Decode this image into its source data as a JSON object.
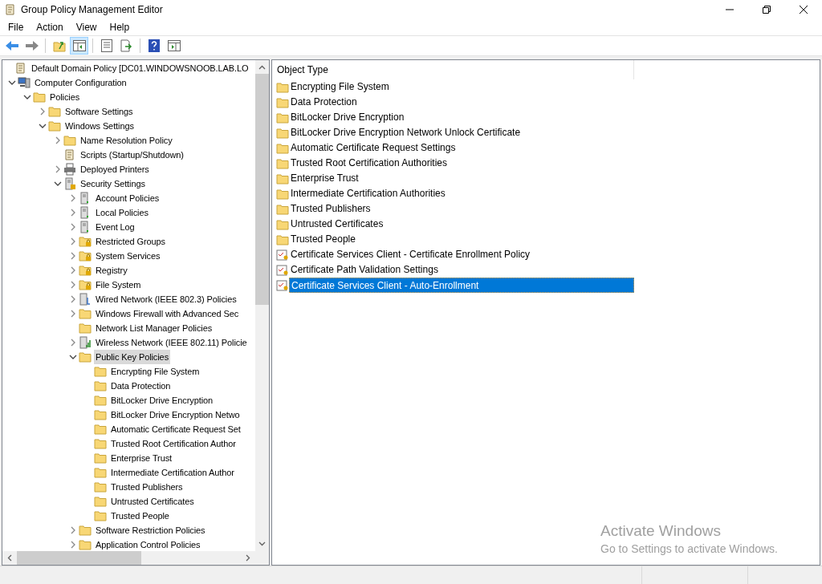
{
  "window": {
    "title": "Group Policy Management Editor"
  },
  "menu": [
    {
      "label": "File"
    },
    {
      "label": "Action"
    },
    {
      "label": "View"
    },
    {
      "label": "Help"
    }
  ],
  "toolbar": [
    {
      "kind": "back",
      "pressed": false
    },
    {
      "kind": "forward",
      "pressed": false
    },
    {
      "kind": "up",
      "pressed": false
    },
    {
      "kind": "tree",
      "pressed": true
    },
    {
      "kind": "properties",
      "pressed": false
    },
    {
      "kind": "export",
      "pressed": false
    },
    {
      "kind": "help",
      "pressed": false
    },
    {
      "kind": "actionpane",
      "pressed": false
    }
  ],
  "tree": [
    {
      "label": "Default Domain Policy [DC01.WINDOWSNOOB.LAB.LO",
      "kind": "policy",
      "selected": false,
      "children": [
        {
          "label": "Computer Configuration",
          "kind": "computer",
          "expanded": true,
          "selected": false,
          "children": [
            {
              "label": "Policies",
              "kind": "folder",
              "expanded": true,
              "selected": false,
              "children": [
                {
                  "label": "Software Settings",
                  "kind": "folder",
                  "expanded": false,
                  "selected": false
                },
                {
                  "label": "Windows Settings",
                  "kind": "folder",
                  "expanded": true,
                  "selected": false,
                  "children": [
                    {
                      "label": "Name Resolution Policy",
                      "kind": "folder",
                      "expanded": false,
                      "selected": false
                    },
                    {
                      "label": "Scripts (Startup/Shutdown)",
                      "kind": "script",
                      "selected": false
                    },
                    {
                      "label": "Deployed Printers",
                      "kind": "printer",
                      "expanded": false,
                      "selected": false
                    },
                    {
                      "label": "Security Settings",
                      "kind": "security",
                      "expanded": true,
                      "selected": false,
                      "children": [
                        {
                          "label": "Account Policies",
                          "kind": "server",
                          "expanded": false,
                          "selected": false
                        },
                        {
                          "label": "Local Policies",
                          "kind": "server",
                          "expanded": false,
                          "selected": false
                        },
                        {
                          "label": "Event Log",
                          "kind": "server",
                          "expanded": false,
                          "selected": false
                        },
                        {
                          "label": "Restricted Groups",
                          "kind": "locked",
                          "expanded": false,
                          "selected": false
                        },
                        {
                          "label": "System Services",
                          "kind": "locked",
                          "expanded": false,
                          "selected": false
                        },
                        {
                          "label": "Registry",
                          "kind": "locked",
                          "expanded": false,
                          "selected": false
                        },
                        {
                          "label": "File System",
                          "kind": "locked",
                          "expanded": false,
                          "selected": false
                        },
                        {
                          "label": "Wired Network (IEEE 802.3) Policies",
                          "kind": "wired",
                          "expanded": false,
                          "selected": false
                        },
                        {
                          "label": "Windows Firewall with Advanced Sec",
                          "kind": "folder",
                          "expanded": false,
                          "selected": false
                        },
                        {
                          "label": "Network List Manager Policies",
                          "kind": "folder",
                          "selected": false
                        },
                        {
                          "label": "Wireless Network (IEEE 802.11) Policie",
                          "kind": "wireless",
                          "expanded": false,
                          "selected": false
                        },
                        {
                          "label": "Public Key Policies",
                          "kind": "folder",
                          "expanded": true,
                          "selected": true,
                          "children": [
                            {
                              "label": "Encrypting File System",
                              "kind": "folder",
                              "selected": false
                            },
                            {
                              "label": "Data Protection",
                              "kind": "folder",
                              "selected": false
                            },
                            {
                              "label": "BitLocker Drive Encryption",
                              "kind": "folder",
                              "selected": false
                            },
                            {
                              "label": "BitLocker Drive Encryption Netwo",
                              "kind": "folder",
                              "selected": false
                            },
                            {
                              "label": "Automatic Certificate Request Set",
                              "kind": "folder",
                              "selected": false
                            },
                            {
                              "label": "Trusted Root Certification Author",
                              "kind": "folder",
                              "selected": false
                            },
                            {
                              "label": "Enterprise Trust",
                              "kind": "folder",
                              "selected": false
                            },
                            {
                              "label": "Intermediate Certification Author",
                              "kind": "folder",
                              "selected": false
                            },
                            {
                              "label": "Trusted Publishers",
                              "kind": "folder",
                              "selected": false
                            },
                            {
                              "label": "Untrusted Certificates",
                              "kind": "folder",
                              "selected": false
                            },
                            {
                              "label": "Trusted People",
                              "kind": "folder",
                              "selected": false
                            }
                          ]
                        },
                        {
                          "label": "Software Restriction Policies",
                          "kind": "folder",
                          "expanded": false,
                          "selected": false
                        },
                        {
                          "label": "Application Control Policies",
                          "kind": "folder",
                          "expanded": false,
                          "selected": false
                        }
                      ]
                    }
                  ]
                }
              ]
            }
          ]
        }
      ]
    }
  ],
  "list": {
    "column": "Object Type",
    "items": [
      {
        "label": "Encrypting File System",
        "kind": "folder",
        "selected": false
      },
      {
        "label": "Data Protection",
        "kind": "folder",
        "selected": false
      },
      {
        "label": "BitLocker Drive Encryption",
        "kind": "folder",
        "selected": false
      },
      {
        "label": "BitLocker Drive Encryption Network Unlock Certificate",
        "kind": "folder",
        "selected": false
      },
      {
        "label": "Automatic Certificate Request Settings",
        "kind": "folder",
        "selected": false
      },
      {
        "label": "Trusted Root Certification Authorities",
        "kind": "folder",
        "selected": false
      },
      {
        "label": "Enterprise Trust",
        "kind": "folder",
        "selected": false
      },
      {
        "label": "Intermediate Certification Authorities",
        "kind": "folder",
        "selected": false
      },
      {
        "label": "Trusted Publishers",
        "kind": "folder",
        "selected": false
      },
      {
        "label": "Untrusted Certificates",
        "kind": "folder",
        "selected": false
      },
      {
        "label": "Trusted People",
        "kind": "folder",
        "selected": false
      },
      {
        "label": "Certificate Services Client - Certificate Enrollment Policy",
        "kind": "setting",
        "selected": false
      },
      {
        "label": "Certificate Path Validation Settings",
        "kind": "setting",
        "selected": false
      },
      {
        "label": "Certificate Services Client - Auto-Enrollment",
        "kind": "setting",
        "selected": true
      }
    ]
  },
  "activation_notice": {
    "title": "Activate Windows",
    "message": "Go to Settings to activate Windows."
  }
}
